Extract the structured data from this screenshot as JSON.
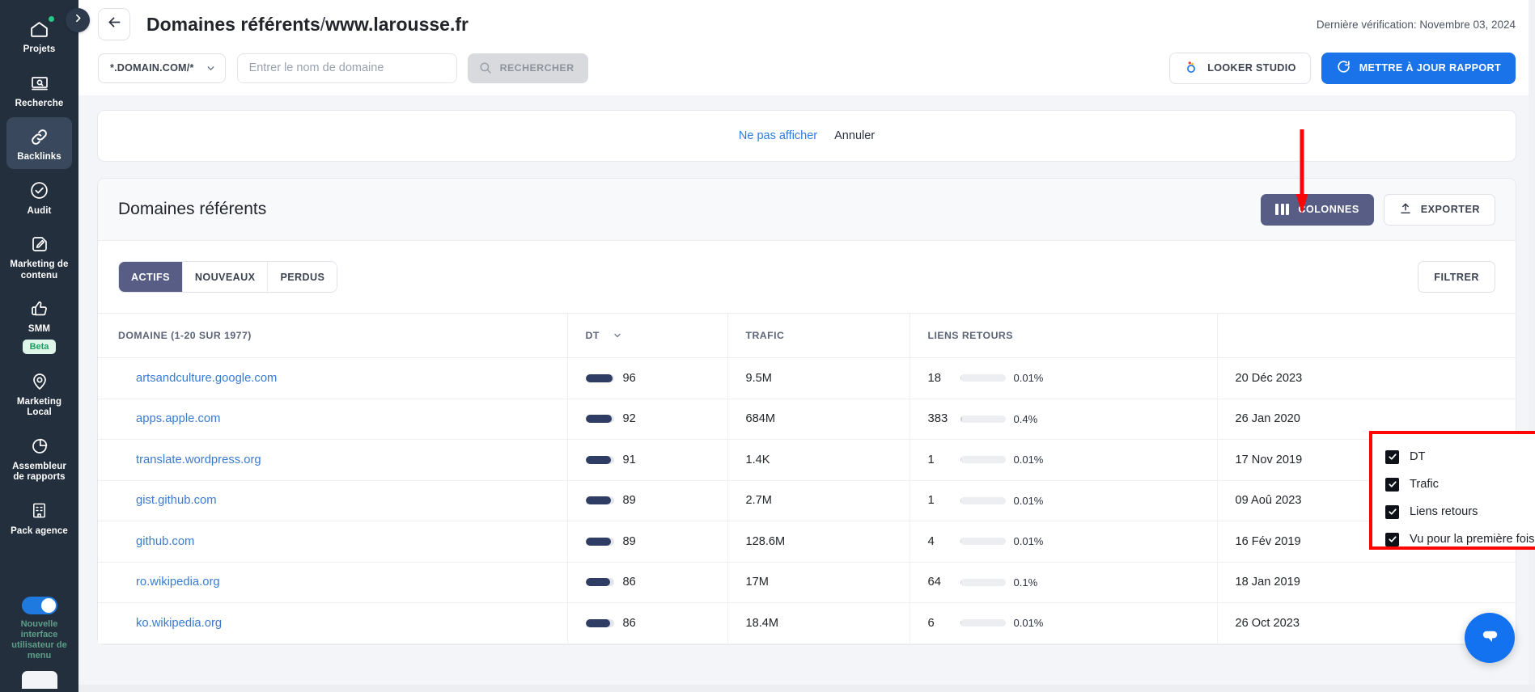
{
  "sidebar": {
    "items": [
      {
        "label": "Projets",
        "icon": "home-icon",
        "badge_dot": true,
        "active": false
      },
      {
        "label": "Recherche",
        "icon": "search-screen-icon",
        "active": false
      },
      {
        "label": "Backlinks",
        "icon": "link-icon",
        "active": true
      },
      {
        "label": "Audit",
        "icon": "check-circle-icon",
        "active": false
      },
      {
        "label": "Marketing de contenu",
        "icon": "pencil-square-icon",
        "active": false
      },
      {
        "label": "SMM",
        "icon": "thumbs-up-icon",
        "tag": "Beta",
        "active": false
      },
      {
        "label": "Marketing Local",
        "icon": "location-pin-icon",
        "active": false
      },
      {
        "label": "Assembleur de rapports",
        "icon": "pie-chart-icon",
        "active": false
      },
      {
        "label": "Pack agence",
        "icon": "building-icon",
        "active": false
      }
    ],
    "toggle_label": "Nouvelle interface utilisateur de menu",
    "toggle_on": true,
    "collapse_icon": "chevron-right-icon"
  },
  "header": {
    "back_icon": "arrow-left-icon",
    "title": "Domaines référents",
    "separator": "/",
    "host": "www.larousse.fr",
    "last_check": "Dernière vérification: Novembre 03, 2024"
  },
  "searchbar": {
    "scope_value": "*.DOMAIN.COM/*",
    "scope_chevron_icon": "chevron-down-icon",
    "input_placeholder": "Entrer le nom de domaine",
    "input_value": "",
    "search_label": "RECHERCHER",
    "search_icon": "magnifier-icon",
    "looker_label": "LOOKER STUDIO",
    "looker_icon": "looker-studio-icon",
    "update_label": "METTRE À JOUR RAPPORT",
    "update_icon": "refresh-icon"
  },
  "notice": {
    "dismiss_label": "Ne pas afficher",
    "cancel_label": "Annuler"
  },
  "card": {
    "title": "Domaines référents",
    "columns_label": "COLONNES",
    "columns_icon": "columns-icon",
    "export_label": "EXPORTER",
    "export_icon": "upload-icon",
    "filter_label": "FILTRER",
    "tabs": [
      {
        "label": "ACTIFS",
        "active": true
      },
      {
        "label": "NOUVEAUX",
        "active": false
      },
      {
        "label": "PERDUS",
        "active": false
      }
    ]
  },
  "columns_dropdown": {
    "open": true,
    "highlight_color": "#fb0505",
    "items": [
      {
        "label": "DT",
        "checked": true
      },
      {
        "label": "Trafic",
        "checked": true
      },
      {
        "label": "Liens retours",
        "checked": true
      },
      {
        "label": "Vu pour la première fois",
        "checked": true
      }
    ]
  },
  "table": {
    "headers": {
      "domain": "DOMAINE (1-20 SUR 1977)",
      "dt": "DT",
      "traffic": "TRAFIC",
      "backlinks": "LIENS RETOURS",
      "firstseen": ""
    },
    "sort_column": "DT",
    "sort_icon": "chevron-down-icon",
    "rows": [
      {
        "domain": "artsandculture.google.com",
        "dt": 96,
        "traffic": "9.5M",
        "backlinks": "18",
        "backlinks_pct": "0.01%",
        "first_seen": "20 Déc 2023"
      },
      {
        "domain": "apps.apple.com",
        "dt": 92,
        "traffic": "684M",
        "backlinks": "383",
        "backlinks_pct": "0.4%",
        "first_seen": "26 Jan 2020"
      },
      {
        "domain": "translate.wordpress.org",
        "dt": 91,
        "traffic": "1.4K",
        "backlinks": "1",
        "backlinks_pct": "0.01%",
        "first_seen": "17 Nov 2019"
      },
      {
        "domain": "gist.github.com",
        "dt": 89,
        "traffic": "2.7M",
        "backlinks": "1",
        "backlinks_pct": "0.01%",
        "first_seen": "09 Aoû 2023"
      },
      {
        "domain": "github.com",
        "dt": 89,
        "traffic": "128.6M",
        "backlinks": "4",
        "backlinks_pct": "0.01%",
        "first_seen": "16 Fév 2019"
      },
      {
        "domain": "ro.wikipedia.org",
        "dt": 86,
        "traffic": "17M",
        "backlinks": "64",
        "backlinks_pct": "0.1%",
        "first_seen": "18 Jan 2019"
      },
      {
        "domain": "ko.wikipedia.org",
        "dt": 86,
        "traffic": "18.4M",
        "backlinks": "6",
        "backlinks_pct": "0.01%",
        "first_seen": "26 Oct 2023"
      }
    ]
  },
  "chat_widget": {
    "icon": "chat-bubble-icon"
  },
  "colors": {
    "sidebar_bg": "#242f3e",
    "accent_blue": "#1a73e8",
    "purple": "#575d84",
    "link": "#3a7bd0",
    "annotation_red": "#fb0505"
  }
}
